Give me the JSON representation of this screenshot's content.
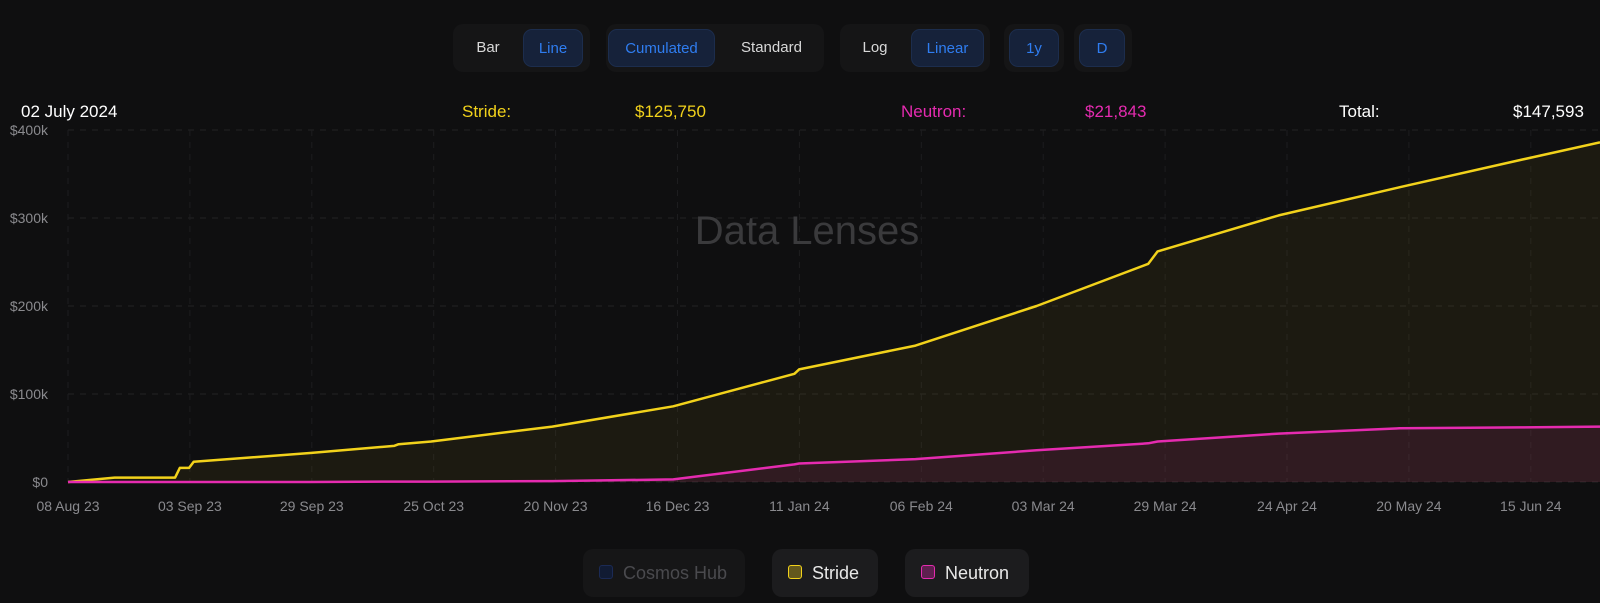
{
  "toolbar": {
    "type_group": {
      "bar": "Bar",
      "line": "Line"
    },
    "mode_group": {
      "cumulated": "Cumulated",
      "standard": "Standard"
    },
    "scale_group": {
      "log": "Log",
      "linear": "Linear"
    },
    "range": "1y",
    "interval": "D"
  },
  "readout": {
    "date": "02 July 2024",
    "stride_label": "Stride:",
    "stride_value": "$125,750",
    "neutron_label": "Neutron:",
    "neutron_value": "$21,843",
    "total_label": "Total:",
    "total_value": "$147,593"
  },
  "watermark": "Data Lenses",
  "legend": [
    {
      "label": "Cosmos Hub",
      "color": "#1b2a55",
      "active": false
    },
    {
      "label": "Stride",
      "color": "#f2d21b",
      "active": true
    },
    {
      "label": "Neutron",
      "color": "#e52bb0",
      "active": true
    }
  ],
  "colors": {
    "stride": "#f2d21b",
    "neutron": "#e52bb0",
    "active_button": "#2f7df0",
    "background": "#0f0f10"
  },
  "chart_data": {
    "type": "line",
    "mode": "cumulative",
    "scale": "linear",
    "grid": true,
    "yticks": [
      "$0",
      "$100k",
      "$200k",
      "$300k",
      "$400k"
    ],
    "ylim": [
      0,
      400000
    ],
    "xticks": [
      "08 Aug 23",
      "03 Sep 23",
      "29 Sep 23",
      "25 Oct 23",
      "20 Nov 23",
      "16 Dec 23",
      "11 Jan 24",
      "06 Feb 24",
      "03 Mar 24",
      "29 Mar 24",
      "24 Apr 24",
      "20 May 24",
      "15 Jun 24"
    ],
    "x": [
      "2023-08-08",
      "2023-08-18",
      "2023-08-31",
      "2023-09-01",
      "2023-09-03",
      "2023-09-04",
      "2023-09-29",
      "2023-10-17",
      "2023-10-18",
      "2023-10-25",
      "2023-11-20",
      "2023-12-16",
      "2024-01-11",
      "2024-01-12",
      "2024-02-06",
      "2024-03-03",
      "2024-03-27",
      "2024-03-29",
      "2024-04-24",
      "2024-05-20",
      "2024-06-15",
      "2024-07-02"
    ],
    "series": [
      {
        "name": "Stride",
        "values": [
          0,
          5000,
          5000,
          16000,
          16000,
          23000,
          33000,
          41000,
          43000,
          46000,
          63000,
          86000,
          123000,
          128000,
          155000,
          200000,
          248000,
          262000,
          303000,
          335000,
          366000,
          386000
        ]
      },
      {
        "name": "Neutron",
        "values": [
          0,
          0,
          0,
          0,
          0,
          0,
          0,
          500,
          500,
          500,
          1000,
          3000,
          20000,
          21000,
          26000,
          36000,
          44000,
          46000,
          55000,
          61000,
          62000,
          63000
        ]
      }
    ]
  }
}
